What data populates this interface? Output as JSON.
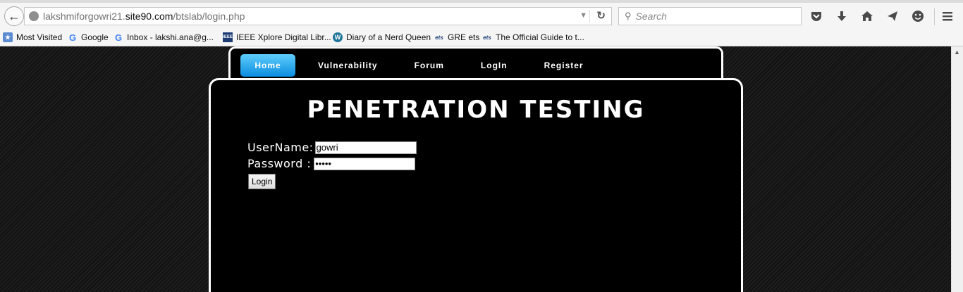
{
  "browser": {
    "url": {
      "prefix": "lakshmiforgowri21.",
      "domain": "site90.com",
      "path": "/btslab/login.php"
    },
    "search_placeholder": "Search",
    "bookmarks": [
      {
        "label": "Most Visited",
        "icon": "bookmarks-folder-icon"
      },
      {
        "label": "Google",
        "icon": "google-g-icon"
      },
      {
        "label": "Inbox - lakshi.ana@g...",
        "icon": "google-g-icon"
      },
      {
        "label": "IEEE Xplore Digital Libr...",
        "icon": "ieee-icon"
      },
      {
        "label": "Diary of a Nerd Queen",
        "icon": "wordpress-icon"
      },
      {
        "label": "GRE ets",
        "icon": "ets-icon"
      },
      {
        "label": "The Official Guide to t...",
        "icon": "ets-icon"
      }
    ]
  },
  "nav": {
    "items": [
      "Home",
      "Vulnerability",
      "Forum",
      "LogIn",
      "Register"
    ],
    "active": "Home"
  },
  "page": {
    "title": "PENETRATION TESTING",
    "username_label": "UserName:",
    "username_value": "gowri",
    "password_label": "Password :",
    "password_value": "gowri",
    "login_label": "Login"
  },
  "colors": {
    "nav_active": "#1aa3ec",
    "panel_bg": "#000000",
    "panel_border": "#ffffff",
    "page_bg": "#161616"
  }
}
